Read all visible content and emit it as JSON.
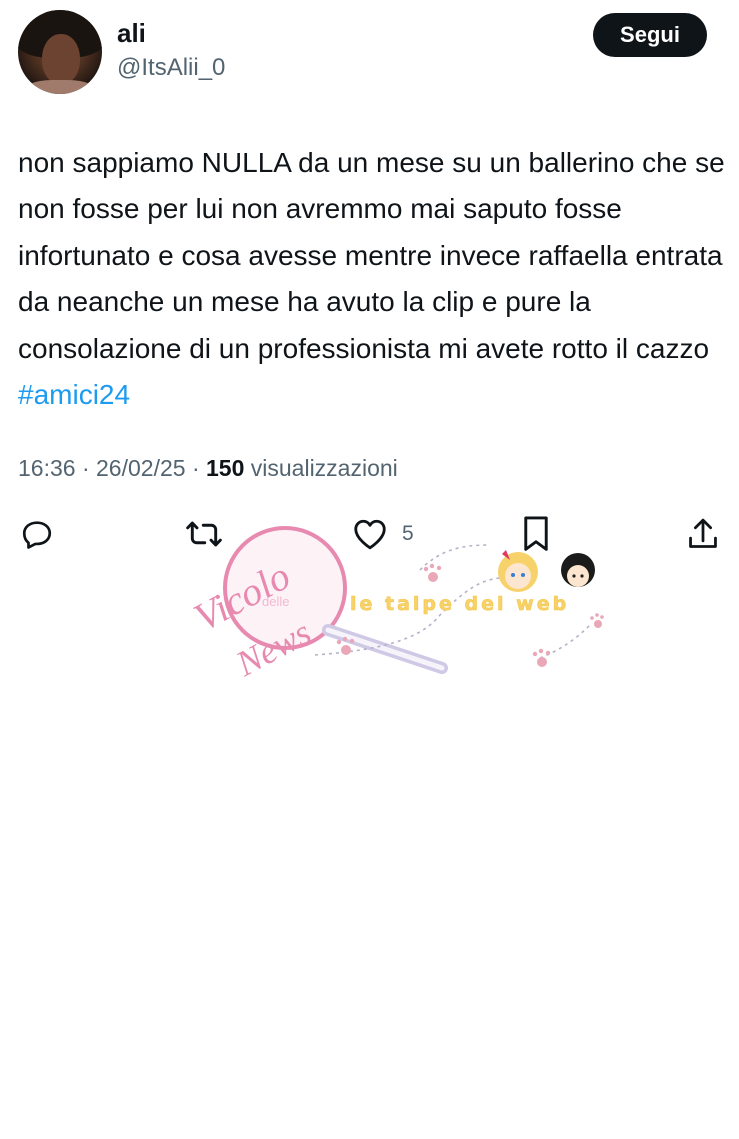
{
  "user": {
    "name": "ali",
    "handle": "@ItsAlii_0"
  },
  "follow_button": {
    "label": "Segui"
  },
  "tweet": {
    "text": "non sappiamo NULLA da un mese su un ballerino che se non fosse per lui non avremmo mai saputo fosse infortunato e cosa avesse mentre invece raffaella entrata da neanche un mese ha avuto la clip e pure la consolazione di un professionista mi avete rotto il cazzo",
    "hashtag": "#amici24"
  },
  "meta": {
    "time": "16:36",
    "separator": "·",
    "date": "26/02/25",
    "views_count": "150",
    "views_label": "visualizzazioni"
  },
  "actions": {
    "like_count": "5"
  },
  "icons": {
    "reply": "reply-icon",
    "repost": "repost-icon",
    "like": "heart-icon",
    "bookmark": "bookmark-icon",
    "share": "share-icon"
  },
  "watermark": {
    "brand_line1": "Vicolo",
    "brand_line2": "delle",
    "brand_line3": "News",
    "tagline": "le talpe del web"
  },
  "colors": {
    "text": "#0f1419",
    "secondary": "#536471",
    "link": "#1d9bf0",
    "button_bg": "#0f1419",
    "watermark_pink": "#e88ab0"
  }
}
